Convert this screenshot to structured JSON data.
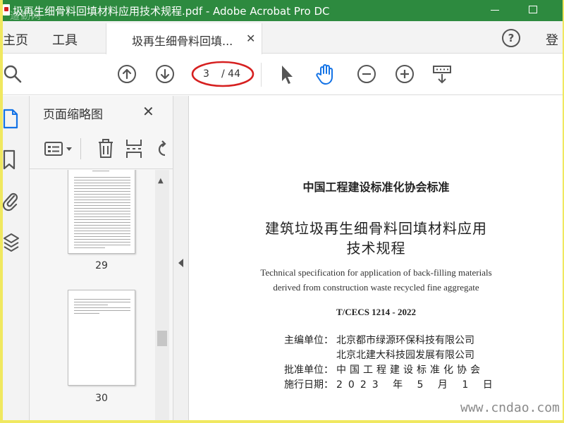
{
  "window": {
    "title": "圾再生细骨料回填材料应用技术规程.pdf - Adobe Acrobat Pro DC",
    "watermark": "道勤网"
  },
  "tabs": {
    "home": "主页",
    "tools": "工具",
    "document_tab": "圾再生细骨料回填...",
    "help": "?",
    "signin": "登"
  },
  "toolbar": {
    "current_page": "3",
    "total_pages": "/ 44",
    "highlight_color": "#d62020"
  },
  "thumbnails_panel": {
    "title": "页面缩略图",
    "close": "✕",
    "pages": [
      {
        "number": "29"
      },
      {
        "number": "30"
      }
    ]
  },
  "document": {
    "organization": "中国工程建设标准化协会标准",
    "title_line1": "建筑垃圾再生细骨料回填材料应用",
    "title_line2": "技术规程",
    "english_line1": "Technical specification for application of back-filling materials",
    "english_line2": "derived from construction waste recycled fine aggregate",
    "code": "T/CECS 1214 - 2022",
    "chief_editor_label": "主编单位：",
    "chief_editor_1": "北京都市绿源环保科技有限公司",
    "chief_editor_2": "北京北建大科技园发展有限公司",
    "approval_label": "批准单位：",
    "approval_value": "中国工程建设标准化协会",
    "effective_label": "施行日期：",
    "effective_value": "2023 年 5 月 1 日"
  },
  "overlay": {
    "site": "www.cndao.com"
  },
  "colors": {
    "titlebar": "#2d8a3f",
    "frame": "#f0e860"
  }
}
